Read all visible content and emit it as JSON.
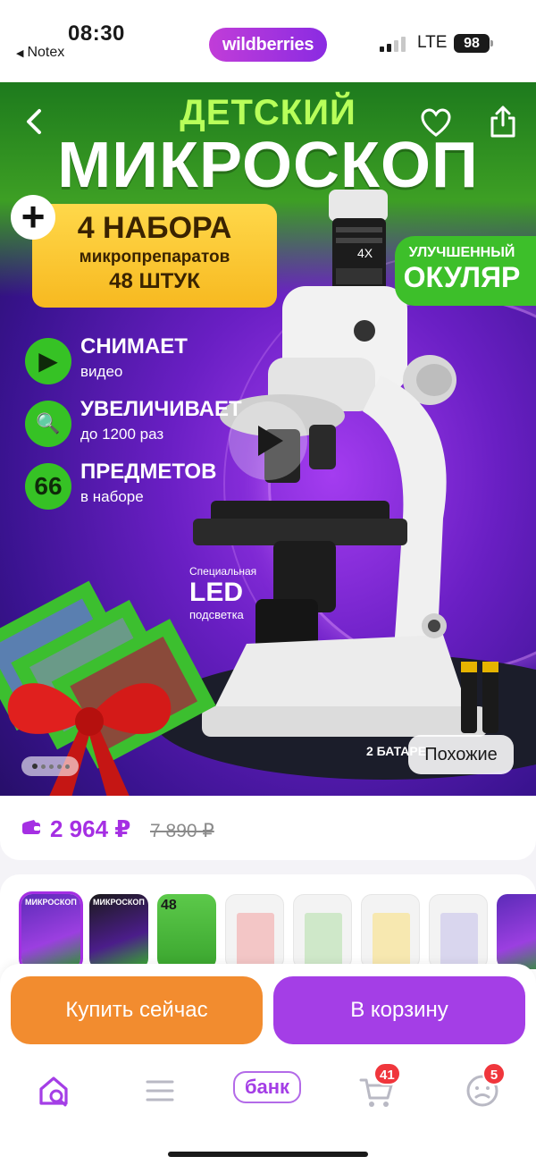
{
  "status_bar": {
    "time": "08:30",
    "back_app": "Notex",
    "network": "LTE",
    "battery": "98"
  },
  "header": {
    "brand": "wildberries"
  },
  "hero": {
    "title_small": "ДЕТСКИЙ",
    "title_large": "МИКРОСКОП",
    "plus": "+",
    "promo": {
      "line1": "4 НАБОРА",
      "line2": "микропрепаратов",
      "line3": "48 ШТУК"
    },
    "ocular": {
      "line1": "УЛУЧШЕННЫЙ",
      "line2": "ОКУЛЯР"
    },
    "features": [
      {
        "badge": "▶",
        "title": "СНИМАЕТ",
        "subtitle": "видео"
      },
      {
        "badge": "🔍",
        "title": "УВЕЛИЧИВАЕТ",
        "subtitle": "до 1200 раз"
      },
      {
        "badge": "66",
        "title": "ПРЕДМЕТОВ",
        "subtitle": "в наборе"
      }
    ],
    "led_note": {
      "small": "Специальная",
      "big": "LED",
      "sub": "подсветка"
    },
    "battery_caption": "2 БАТАРЕ",
    "similar_button": "Похожие",
    "slide_count": 5,
    "active_slide": 0
  },
  "price": {
    "current": "2 964 ₽",
    "old": "7 890 ₽"
  },
  "thumbnails": [
    {
      "label": "МИКРОСКОП",
      "style": "t1",
      "selected": true
    },
    {
      "label": "МИКРОСКОП",
      "style": "t2",
      "selected": false
    },
    {
      "label": "48",
      "style": "t3",
      "selected": false
    },
    {
      "label": "",
      "style": "lt",
      "inner": "#f3c6c6",
      "selected": false
    },
    {
      "label": "",
      "style": "lt",
      "inner": "#cfe8c9",
      "selected": false
    },
    {
      "label": "",
      "style": "lt",
      "inner": "#f7e8b0",
      "selected": false
    },
    {
      "label": "",
      "style": "lt",
      "inner": "#d9d6ee",
      "selected": false
    },
    {
      "label": "",
      "style": "t1",
      "selected": false
    }
  ],
  "actions": {
    "buy_now": "Купить сейчас",
    "add_to_cart": "В корзину"
  },
  "bottom_nav": {
    "bank_label": "банк",
    "cart_badge": "41",
    "profile_badge": "5"
  },
  "colors": {
    "accent": "#a43ee6",
    "buy": "#f28c2f",
    "price": "#a52fe3",
    "badge": "#f0363c"
  }
}
